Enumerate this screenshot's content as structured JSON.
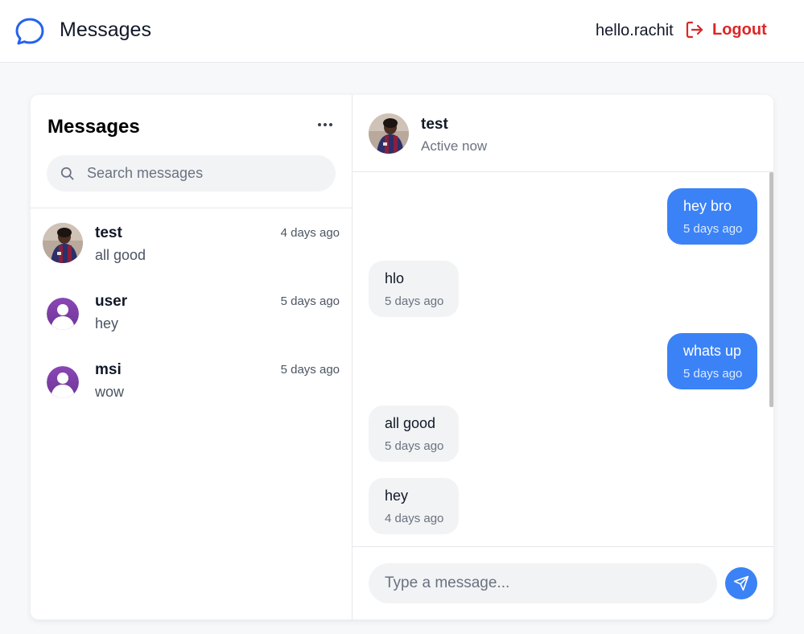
{
  "header": {
    "brand_icon": "chat-bubble-icon",
    "title": "Messages",
    "username": "hello.rachit",
    "logout_label": "Logout",
    "logout_icon": "logout-icon"
  },
  "sidebar": {
    "title": "Messages",
    "more_icon": "more-horizontal-icon",
    "search": {
      "placeholder": "Search messages",
      "value": "",
      "icon": "search-icon"
    },
    "conversations": [
      {
        "name": "test",
        "time": "4 days ago",
        "preview": "all good",
        "avatar": "photo-avatar"
      },
      {
        "name": "user",
        "time": "5 days ago",
        "preview": "hey",
        "avatar": "default-user-avatar"
      },
      {
        "name": "msi",
        "time": "5 days ago",
        "preview": "wow",
        "avatar": "default-user-avatar"
      }
    ]
  },
  "chat": {
    "contact_name": "test",
    "status": "Active now",
    "messages": [
      {
        "direction": "sent",
        "text": "hey bro",
        "time": "5 days ago"
      },
      {
        "direction": "received",
        "text": "hlo",
        "time": "5 days ago"
      },
      {
        "direction": "sent",
        "text": "whats up",
        "time": "5 days ago"
      },
      {
        "direction": "received",
        "text": "all good",
        "time": "5 days ago"
      },
      {
        "direction": "received",
        "text": "hey",
        "time": "4 days ago"
      }
    ],
    "composer": {
      "placeholder": "Type a message...",
      "value": "",
      "send_icon": "send-icon"
    }
  },
  "colors": {
    "accent": "#3b82f6",
    "logout": "#dc2626",
    "received_bubble": "#f1f3f5",
    "avatar_purple": "#7e3fa8"
  }
}
